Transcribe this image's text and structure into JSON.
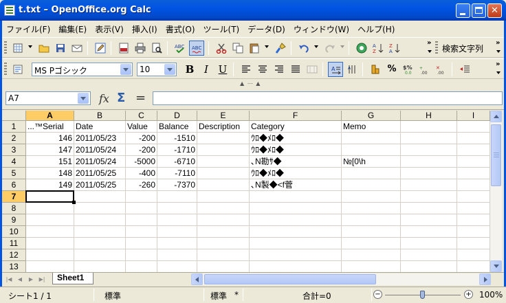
{
  "window": {
    "title": "t.txt – OpenOffice.org Calc"
  },
  "menu": [
    "ファイル(F)",
    "編集(E)",
    "表示(V)",
    "挿入(I)",
    "書式(O)",
    "ツール(T)",
    "データ(D)",
    "ウィンドウ(W)",
    "ヘルプ(H)"
  ],
  "toolbar": {
    "search_label": "検索文字列",
    "font_name": "MS Pゴシック",
    "font_size": "10",
    "bold": "B",
    "italic": "I",
    "underline": "U",
    "percent": "%"
  },
  "formula_bar": {
    "name_box": "A7",
    "content": ""
  },
  "grid": {
    "columns": [
      "A",
      "B",
      "C",
      "D",
      "E",
      "F",
      "G",
      "H",
      "I"
    ],
    "rows": [
      "1",
      "2",
      "3",
      "4",
      "5",
      "6",
      "7",
      "8",
      "9",
      "10",
      "11",
      "12",
      "13"
    ],
    "selected_column": "A",
    "selected_row": "7",
    "header": [
      "...™Serial",
      "Date",
      "Value",
      "Balance",
      "Description",
      "Category",
      "Memo",
      "",
      ""
    ],
    "data": [
      [
        "146",
        "2011/05/23",
        "-200",
        "-1510",
        "",
        "ｳﾛ◆ﾒﾛ◆",
        "",
        "",
        ""
      ],
      [
        "147",
        "2011/05/24",
        "-200",
        "-1710",
        "",
        "ｳﾛ◆ﾒﾛ◆",
        "",
        "",
        ""
      ],
      [
        "151",
        "2011/05/24",
        "-5000",
        "-6710",
        "",
        "､N勘ｻ◆",
        "№[0\\h",
        "",
        ""
      ],
      [
        "148",
        "2011/05/25",
        "-400",
        "-7110",
        "",
        "ｳﾛ◆ﾒﾛ◆",
        "",
        "",
        ""
      ],
      [
        "149",
        "2011/05/25",
        "-260",
        "-7370",
        "",
        "､N製◆<f菅",
        "",
        "",
        ""
      ]
    ]
  },
  "sheets": {
    "active": "Sheet1"
  },
  "status": {
    "sheet_pos": "シート1 / 1",
    "page_style": "標準",
    "mode": "標準",
    "modified": "*",
    "sum": "合計=0",
    "zoom": "100%",
    "zoom_level": 1.0
  }
}
